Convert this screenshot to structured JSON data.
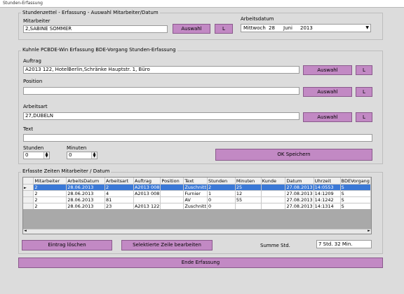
{
  "window": {
    "title": "Stunden-Erfassung"
  },
  "top_group": {
    "legend": "Stundenzettel - Erfassung  -  Auswahl Mitarbeiter/Datum",
    "mitarbeiter_label": "Mitarbeiter",
    "mitarbeiter_value": "2,SABINE SOMMER",
    "auswahl_label": "Auswahl",
    "l_label": "L",
    "arbeitsdatum_label": "Arbeitsdatum",
    "date": {
      "weekday": "Mittwoch",
      "day": "28",
      "month": "Juni",
      "year": "2013"
    }
  },
  "mid_group": {
    "legend": "Kuhnle PCBDE-Win Erfassung BDE-Vorgang Stunden-Erfassung",
    "auftrag_label": "Auftrag",
    "auftrag_value": "A2013 122, HotelBerlin,Schränke Hauptstr. 1, Büro",
    "position_label": "Position",
    "position_value": "",
    "arbeitsart_label": "Arbeitsart",
    "arbeitsart_value": "27,DÜBELN",
    "text_label": "Text",
    "text_value": "",
    "stunden_label": "Stunden",
    "stunden_value": "0",
    "minuten_label": "Minuten",
    "minuten_value": "0",
    "auswahl_label": "Auswahl",
    "l_label": "L",
    "ok_label": "OK Speichern"
  },
  "bottom_group": {
    "legend": "Erfasste Zeiten Mitarbeiter / Datum",
    "columns": [
      "Mitarbeiter",
      "ArbeitsDatum",
      "Arbeitsart",
      "Auftrag",
      "Position",
      "Text",
      "Stunden",
      "Minuten",
      "Kunde",
      "Datum",
      "Uhrzeit",
      "BDEVorgang"
    ],
    "rows": [
      [
        "2",
        "28.06.2013",
        "2",
        "A2013 008",
        "",
        "Zuschnitt",
        "2",
        "25",
        "",
        "27.08.2013",
        "14:0553",
        "S"
      ],
      [
        "2",
        "28.06.2013",
        "4",
        "A2013 008",
        "",
        "Furnier",
        "1",
        "12",
        "",
        "27.08.2013",
        "14:1209",
        "S"
      ],
      [
        "2",
        "28.06.2013",
        "81",
        "",
        "",
        "AV",
        "0",
        "55",
        "",
        "27.08.2013",
        "14:1242",
        "S"
      ],
      [
        "2",
        "28.06.2013",
        "23",
        "A2013 122",
        "",
        "Zuschnitt",
        "0",
        "",
        "",
        "27.08.2013",
        "14:1314",
        "S"
      ]
    ],
    "eintrag_loeschen_label": "Eintrag löschen",
    "zeile_bearbeiten_label": "Selektierte Zeile bearbeiten",
    "summe_label": "Summe Std.",
    "summe_value": "7 Std. 32 Min."
  },
  "ende_label": "Ende Erfassung"
}
